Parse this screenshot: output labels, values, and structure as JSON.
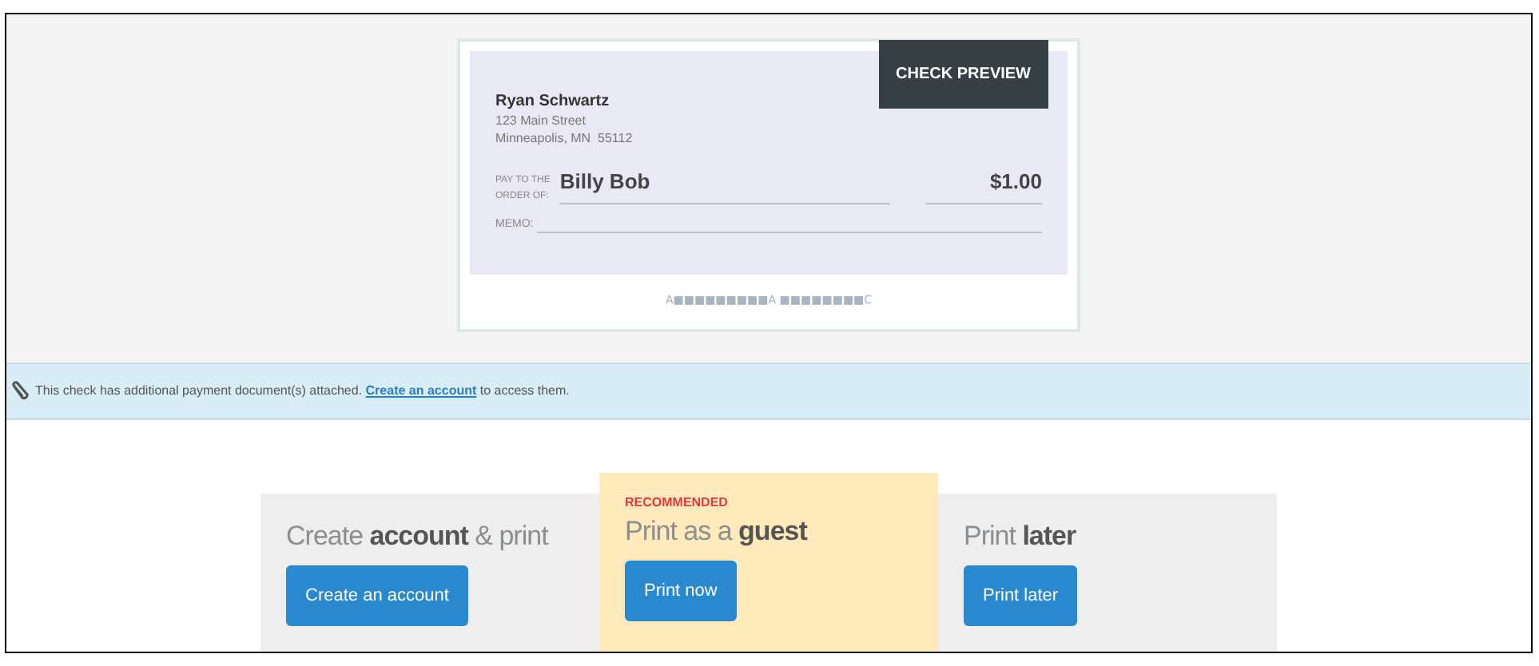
{
  "check": {
    "badge": "CHECK PREVIEW",
    "payer_name": "Ryan Schwartz",
    "address_lines": [
      "123 Main Street",
      "Minneapolis, MN  55112"
    ],
    "pay_to_label": [
      "PAY TO THE",
      "ORDER OF:"
    ],
    "payee": "Billy Bob",
    "amount": "$1.00",
    "memo_label": "MEMO:",
    "micr_line": "A■■■■■■■■■A ■■■■■■■■C"
  },
  "notice": {
    "before": "This check has additional payment document(s) attached.",
    "link": "Create an account",
    "after": "to access them."
  },
  "options": [
    {
      "title": "Create **account** & print",
      "button": "Create an account",
      "recommended": false
    },
    {
      "tag": "RECOMMENDED",
      "title": "Print as a **guest**",
      "button": "Print now",
      "recommended": true
    },
    {
      "title": "Print **later**",
      "button": "Print later",
      "recommended": false
    }
  ]
}
